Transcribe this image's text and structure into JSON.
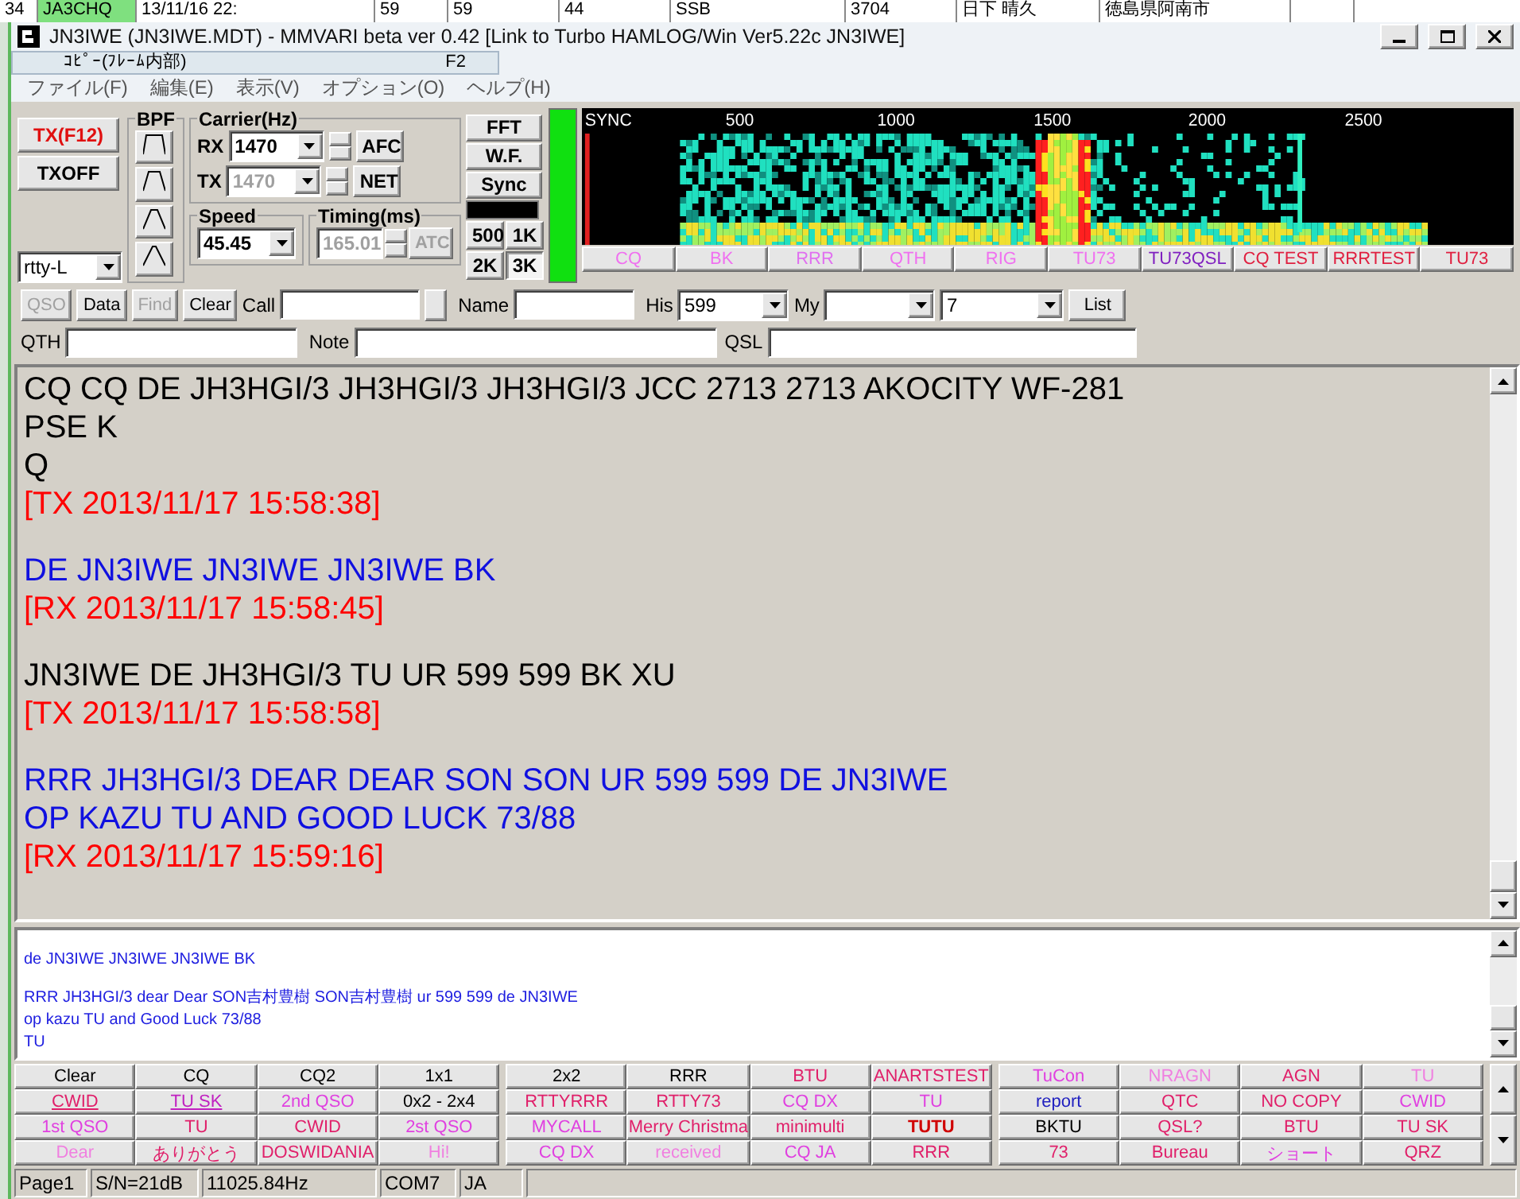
{
  "background_row": {
    "cells": [
      "34",
      "JA3CHQ",
      "13/11/16 22:",
      "59",
      "59",
      "44",
      "SSB",
      "3704",
      "日下 晴久",
      "徳島県阿南市"
    ]
  },
  "window": {
    "title": "JN3IWE (JN3IWE.MDT) - MMVARI beta ver 0.42 [Link to Turbo HAMLOG/Win Ver5.22c JN3IWE]"
  },
  "menu": {
    "items": [
      "ファイル(F)",
      "編集(E)",
      "表示(V)",
      "オプション(O)",
      "ヘルプ(H)"
    ],
    "popup": {
      "label": "ｺﾋﾟｰ(ﾌﾚｰﾑ内部)",
      "shortcut": "F2"
    }
  },
  "tx_controls": {
    "tx": "TX(F12)",
    "txoff": "TXOFF",
    "mode": "rtty-L"
  },
  "bpf": {
    "title": "BPF"
  },
  "carrier": {
    "title": "Carrier(Hz)",
    "rx_label": "RX",
    "rx_value": "1470",
    "afc": "AFC",
    "tx_label": "TX",
    "tx_value": "1470",
    "net": "NET"
  },
  "speed": {
    "title": "Speed",
    "value": "45.45"
  },
  "timing": {
    "title": "Timing(ms)",
    "value": "165.01",
    "atc": "ATC"
  },
  "view_buttons": [
    "FFT",
    "W.F.",
    "Sync"
  ],
  "width_buttons": [
    {
      "label": "500",
      "selected": false
    },
    {
      "label": "1K",
      "selected": false
    },
    {
      "label": "2K",
      "selected": false
    },
    {
      "label": "3K",
      "selected": true
    }
  ],
  "waterfall": {
    "scale": [
      "SYNC",
      "500",
      "1000",
      "1500",
      "2000",
      "2500"
    ],
    "macros": [
      {
        "label": "CQ",
        "color": "#f070f0"
      },
      {
        "label": "BK",
        "color": "#f070f0"
      },
      {
        "label": "RRR",
        "color": "#e070f0"
      },
      {
        "label": "QTH",
        "color": "#f070f0"
      },
      {
        "label": "RIG",
        "color": "#f070f0"
      },
      {
        "label": "TU73",
        "color": "#f070f0"
      },
      {
        "label": "TU73QSL",
        "color": "#8020c0"
      },
      {
        "label": "CQ TEST",
        "color": "#e02040"
      },
      {
        "label": "RRRTEST",
        "color": "#e02040"
      },
      {
        "label": "TU73",
        "color": "#e02040"
      }
    ]
  },
  "log": {
    "buttons": [
      {
        "label": "QSO",
        "disabled": true
      },
      {
        "label": "Data",
        "disabled": false
      },
      {
        "label": "Find",
        "disabled": true
      },
      {
        "label": "Clear",
        "disabled": false
      }
    ],
    "call_label": "Call",
    "name_label": "Name",
    "his_label": "His",
    "his_value": "599",
    "my_label": "My",
    "band_value": "7",
    "list": "List",
    "qth_label": "QTH",
    "note_label": "Note",
    "qsl_label": "QSL"
  },
  "rx_text": [
    [
      {
        "text": "CQ CQ DE JH3HGI/3 JH3HGI/3 JH3HGI/3 JCC 2713 2713 AKOCITY WF-281",
        "kind": "received"
      },
      {
        "text": "PSE  K",
        "kind": "received"
      },
      {
        "text": "Q",
        "kind": "received"
      },
      {
        "text": "[TX 2013/11/17 15:58:38]",
        "kind": "marker"
      }
    ],
    [
      {
        "text": "DE JN3IWE JN3IWE JN3IWE BK",
        "kind": "sent"
      },
      {
        "text": "[RX 2013/11/17 15:58:45]",
        "kind": "marker"
      }
    ],
    [
      {
        "text": "JN3IWE DE JH3HGI/3 TU UR 599 599 BK XU",
        "kind": "received"
      },
      {
        "text": "[TX 2013/11/17 15:58:58]",
        "kind": "marker"
      }
    ],
    [
      {
        "text": "RRR JH3HGI/3 DEAR DEAR SON SON UR 599 599 DE JN3IWE",
        "kind": "sent"
      },
      {
        "text": "OP KAZU TU AND GOOD LUCK 73/88",
        "kind": "sent"
      },
      {
        "text": "[RX 2013/11/17 15:59:16]",
        "kind": "marker"
      }
    ]
  ],
  "tx_text": [
    [
      "de JN3IWE JN3IWE JN3IWE BK"
    ],
    [
      "RRR JH3HGI/3 dear Dear SON吉村豊樹 SON吉村豊樹 ur 599 599 de JN3IWE",
      "op kazu TU and Good Luck 73/88",
      "TU"
    ]
  ],
  "macro_blocks": [
    [
      [
        {
          "label": "Clear",
          "color": "#000000"
        },
        {
          "label": "CQ",
          "color": "#000000"
        },
        {
          "label": "CQ2",
          "color": "#000000"
        },
        {
          "label": "1x1",
          "color": "#000000"
        }
      ],
      [
        {
          "label": "CWID",
          "color": "#e0206a",
          "underlined": true
        },
        {
          "label": "TU SK",
          "color": "#c020c0",
          "underlined": true
        },
        {
          "label": "2nd QSO",
          "color": "#e040e0"
        },
        {
          "label": "0x2 - 2x4",
          "color": "#000000"
        }
      ],
      [
        {
          "label": "1st QSO",
          "color": "#e040e0"
        },
        {
          "label": "TU",
          "color": "#e0206a"
        },
        {
          "label": "CWID",
          "color": "#e0206a"
        },
        {
          "label": "2st QSO",
          "color": "#e040e0"
        }
      ],
      [
        {
          "label": "Dear",
          "color": "#f080e0"
        },
        {
          "label": "ありがとう",
          "color": "#e0206a"
        },
        {
          "label": "DOSWIDANIA",
          "color": "#e0206a"
        },
        {
          "label": "Hi!",
          "color": "#f080e0"
        }
      ]
    ],
    [
      [
        {
          "label": "2x2",
          "color": "#000000"
        },
        {
          "label": "RRR",
          "color": "#000000"
        },
        {
          "label": "BTU",
          "color": "#e0206a"
        },
        {
          "label": "ANARTSTEST",
          "color": "#e0206a"
        }
      ],
      [
        {
          "label": "RTTYRRR",
          "color": "#e0206a"
        },
        {
          "label": "RTTY73",
          "color": "#e0206a"
        },
        {
          "label": "CQ DX",
          "color": "#e040e0"
        },
        {
          "label": "TU",
          "color": "#e040e0"
        }
      ],
      [
        {
          "label": "MYCALL",
          "color": "#e040e0"
        },
        {
          "label": "Merry Christma",
          "color": "#e0206a"
        },
        {
          "label": "minimulti",
          "color": "#e0206a"
        },
        {
          "label": "TUTU",
          "color": "#d00000",
          "bold": true
        }
      ],
      [
        {
          "label": "CQ DX",
          "color": "#e040e0"
        },
        {
          "label": "received",
          "color": "#f080e0"
        },
        {
          "label": "CQ JA",
          "color": "#e040e0"
        },
        {
          "label": "RRR",
          "color": "#e0206a"
        }
      ]
    ],
    [
      [
        {
          "label": "TuCon",
          "color": "#e040e0"
        },
        {
          "label": "NRAGN",
          "color": "#f080e0"
        },
        {
          "label": "AGN",
          "color": "#e0206a"
        },
        {
          "label": "TU",
          "color": "#f080e0"
        }
      ],
      [
        {
          "label": "report",
          "color": "#2020c0"
        },
        {
          "label": "QTC",
          "color": "#e0206a"
        },
        {
          "label": "NO COPY",
          "color": "#e0206a"
        },
        {
          "label": "CWID",
          "color": "#e040e0"
        }
      ],
      [
        {
          "label": "BKTU",
          "color": "#000000"
        },
        {
          "label": "QSL?",
          "color": "#e0206a"
        },
        {
          "label": "BTU",
          "color": "#e0206a"
        },
        {
          "label": "TU SK",
          "color": "#e0206a"
        }
      ],
      [
        {
          "label": "73",
          "color": "#e0206a"
        },
        {
          "label": "Bureau",
          "color": "#e0206a"
        },
        {
          "label": "ショート",
          "color": "#e040e0"
        },
        {
          "label": "QRZ",
          "color": "#e0206a"
        }
      ]
    ]
  ],
  "status_bar": [
    "Page1",
    "S/N=21dB",
    "11025.84Hz",
    "COM7",
    "JA"
  ]
}
